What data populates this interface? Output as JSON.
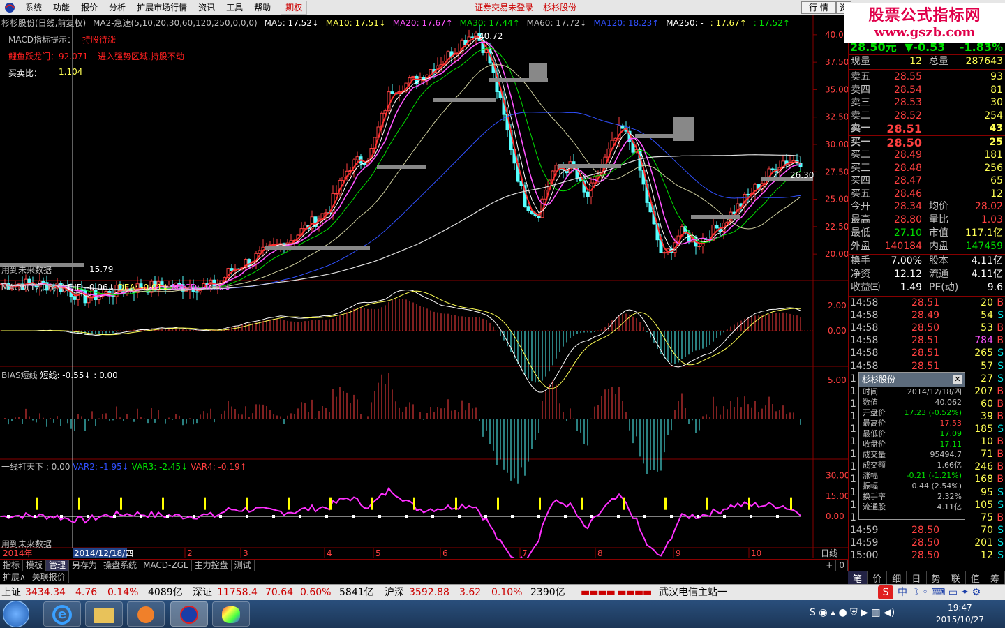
{
  "menu": {
    "items": [
      "系统",
      "功能",
      "报价",
      "分析",
      "扩展市场行情",
      "资讯",
      "工具",
      "帮助"
    ],
    "highlight": "期权",
    "center_notice": "证券交易未登录",
    "center_stock": "杉杉股份",
    "right_btn": "行 情",
    "right_btn2": "资"
  },
  "watermark": {
    "line1": "股票公式指标网",
    "line2": "www.gszb.com"
  },
  "chart_header": {
    "stock": "杉杉股份(日线,前复权)",
    "ma_formula": "MA2-急速(5,10,20,30,60,120,250,0,0,0)",
    "ma5": "MA5: 17.52↓",
    "ma10": "MA10: 17.51↓",
    "ma20": "MA20: 17.67↑",
    "ma30": "MA30: 17.44↑",
    "ma60": "MA60: 17.72↓",
    "ma120": "MA120: 18.23↑",
    "ma250": "MA250: -",
    "extra1": ": 17.67↑",
    "extra2": ": 17.52↑"
  },
  "overlay": {
    "macd_hint_label": "MACD指标提示：",
    "macd_hint_value": "持股待涨",
    "carp_label": "鲤鱼跃龙门：92.071",
    "carp_text": "进入强势区域,持股不动",
    "buysell_label": "买卖比：",
    "buysell_value": "1.104",
    "future_data": "用到未来数据",
    "future_data2": "用到未来数据",
    "high_price_marker": "40.72",
    "low_price_marker": "15.79",
    "right_price_marker": "26.30"
  },
  "price_axis": [
    "40.00",
    "37.50",
    "35.00",
    "32.50",
    "30.00",
    "27.50",
    "25.00",
    "22.50",
    "20.00"
  ],
  "macd_header": {
    "name": "MACD(12,26,9)",
    "dif": "DIF: -0.06↓",
    "dea": "DEA: -0.01↓",
    "macd": "MACD: -0.10↓"
  },
  "macd_axis": [
    "2.00",
    "0.00"
  ],
  "bias_header": {
    "name": "BIAS短线",
    "short": "短线: -0.55↓",
    "extra": ": 0.00"
  },
  "bias_axis": [
    "5.00"
  ],
  "yxtx_header": {
    "name": "一线打天下 : 0.00",
    "var2": "VAR2: -1.95↓",
    "var3": "VAR3: -2.45↓",
    "var4": "VAR4: -0.19↑"
  },
  "yxtx_axis": [
    "30.00",
    "15.00",
    "0.00"
  ],
  "x_axis": {
    "year": "2014年",
    "cursor_date": "2014/12/18/四",
    "months": [
      "2",
      "3",
      "4",
      "5",
      "6",
      "7",
      "8",
      "9",
      "10"
    ],
    "period": "日线"
  },
  "quote": {
    "price": "28.50元",
    "change": "▼-0.53",
    "pct": "-1.83%",
    "now_vol_label": "现量",
    "now_vol": "12",
    "total_vol_label": "总量",
    "total_vol": "287643",
    "asks": [
      {
        "label": "卖五",
        "price": "28.55",
        "vol": "93"
      },
      {
        "label": "卖四",
        "price": "28.54",
        "vol": "81"
      },
      {
        "label": "卖三",
        "price": "28.53",
        "vol": "30"
      },
      {
        "label": "卖二",
        "price": "28.52",
        "vol": "254"
      },
      {
        "label": "卖一",
        "price": "28.51",
        "vol": "43"
      }
    ],
    "bids": [
      {
        "label": "买一",
        "price": "28.50",
        "vol": "25"
      },
      {
        "label": "买二",
        "price": "28.49",
        "vol": "181"
      },
      {
        "label": "买三",
        "price": "28.48",
        "vol": "256"
      },
      {
        "label": "买四",
        "price": "28.47",
        "vol": "65"
      },
      {
        "label": "买五",
        "price": "28.46",
        "vol": "12"
      }
    ],
    "stats": [
      {
        "a": "今开",
        "b": "28.34",
        "c": "均价",
        "d": "28.02"
      },
      {
        "a": "最高",
        "b": "28.80",
        "c": "量比",
        "d": "1.03"
      },
      {
        "a": "最低",
        "b": "27.10",
        "c": "市值",
        "d": "117.1亿"
      },
      {
        "a": "外盘",
        "b": "140184",
        "c": "内盘",
        "d": "147459"
      }
    ],
    "stats2": [
      {
        "a": "换手",
        "b": "7.00%",
        "c": "股本",
        "d": "4.11亿"
      },
      {
        "a": "净资",
        "b": "12.12",
        "c": "流通",
        "d": "4.11亿"
      },
      {
        "a": "收益㈢",
        "b": "1.49",
        "c": "PE(动)",
        "d": "9.6"
      }
    ]
  },
  "ticks": [
    {
      "t": "14:58",
      "p": "28.51",
      "v": "20",
      "s": "B"
    },
    {
      "t": "14:58",
      "p": "28.49",
      "v": "54",
      "s": "S"
    },
    {
      "t": "14:58",
      "p": "28.50",
      "v": "53",
      "s": "B"
    },
    {
      "t": "14:58",
      "p": "28.51",
      "v": "784",
      "s": "B"
    },
    {
      "t": "14:58",
      "p": "28.51",
      "v": "265",
      "s": "S"
    },
    {
      "t": "14:58",
      "p": "28.51",
      "v": "57",
      "s": "S"
    },
    {
      "t": "1",
      "p": "",
      "v": "27",
      "s": "S"
    },
    {
      "t": "1",
      "p": "",
      "v": "207",
      "s": "B"
    },
    {
      "t": "1",
      "p": "",
      "v": "60",
      "s": "B"
    },
    {
      "t": "1",
      "p": "",
      "v": "39",
      "s": "B"
    },
    {
      "t": "1",
      "p": "",
      "v": "185",
      "s": "S"
    },
    {
      "t": "1",
      "p": "",
      "v": "10",
      "s": "B"
    },
    {
      "t": "1",
      "p": "",
      "v": "71",
      "s": "B"
    },
    {
      "t": "1",
      "p": "",
      "v": "246",
      "s": "B"
    },
    {
      "t": "1",
      "p": "",
      "v": "168",
      "s": "B"
    },
    {
      "t": "1",
      "p": "",
      "v": "95",
      "s": "S"
    },
    {
      "t": "1",
      "p": "",
      "v": "105",
      "s": "S"
    },
    {
      "t": "1",
      "p": "",
      "v": "75",
      "s": "B"
    },
    {
      "t": "14:59",
      "p": "28.50",
      "v": "70",
      "s": "S"
    },
    {
      "t": "14:59",
      "p": "28.50",
      "v": "201",
      "s": "S"
    },
    {
      "t": "15:00",
      "p": "28.50",
      "v": "12",
      "s": "S"
    }
  ],
  "popup": {
    "title": "杉杉股份",
    "rows": [
      {
        "k": "时间",
        "v": "2014/12/18/四",
        "c": "#c0c0c0"
      },
      {
        "k": "数值",
        "v": "40.062",
        "c": "#c0c0c0"
      },
      {
        "k": "开盘价",
        "v": "17.23 (-0.52%)",
        "c": "#00e000"
      },
      {
        "k": "最高价",
        "v": "17.53",
        "c": "#ff4040"
      },
      {
        "k": "最低价",
        "v": "17.09",
        "c": "#00e000"
      },
      {
        "k": "收盘价",
        "v": "17.11",
        "c": "#00e000"
      },
      {
        "k": "成交量",
        "v": "95494.7",
        "c": "#c0c0c0"
      },
      {
        "k": "成交额",
        "v": "1.66亿",
        "c": "#c0c0c0"
      },
      {
        "k": "涨幅",
        "v": "-0.21 (-1.21%)",
        "c": "#00e000"
      },
      {
        "k": "振幅",
        "v": "0.44 (2.54%)",
        "c": "#c0c0c0"
      },
      {
        "k": "换手率",
        "v": "2.32%",
        "c": "#c0c0c0"
      },
      {
        "k": "流通股",
        "v": "4.11亿",
        "c": "#c0c0c0"
      }
    ]
  },
  "bottom_tabs": [
    "指标",
    "模板",
    "管理",
    "另存为",
    "操盘系统",
    "MACD-ZGL",
    "主力控盘",
    "测试"
  ],
  "ext_tabs": [
    "扩展∧",
    "关联报价"
  ],
  "right_tabs": [
    "笔",
    "价",
    "细",
    "日",
    "势",
    "联",
    "值",
    "筹"
  ],
  "status": {
    "sh_label": "上证",
    "sh_val": "3434.34",
    "sh_chg": "4.76",
    "sh_pct": "0.14%",
    "sh_amt": "4089亿",
    "sz_label": "深证",
    "sz_val": "11758.4",
    "sz_chg": "70.64",
    "sz_pct": "0.60%",
    "sz_amt": "5841亿",
    "hs_label": "沪深",
    "hs_val": "3592.88",
    "hs_chg": "3.62",
    "hs_pct": "0.10%",
    "hs_amt": "2390亿",
    "server": "武汉电信主站一"
  },
  "clock": {
    "time": "19:47",
    "date": "2015/10/27"
  },
  "colors": {
    "up": "#ff4040",
    "down": "#54ffff",
    "grid": "#800000"
  }
}
